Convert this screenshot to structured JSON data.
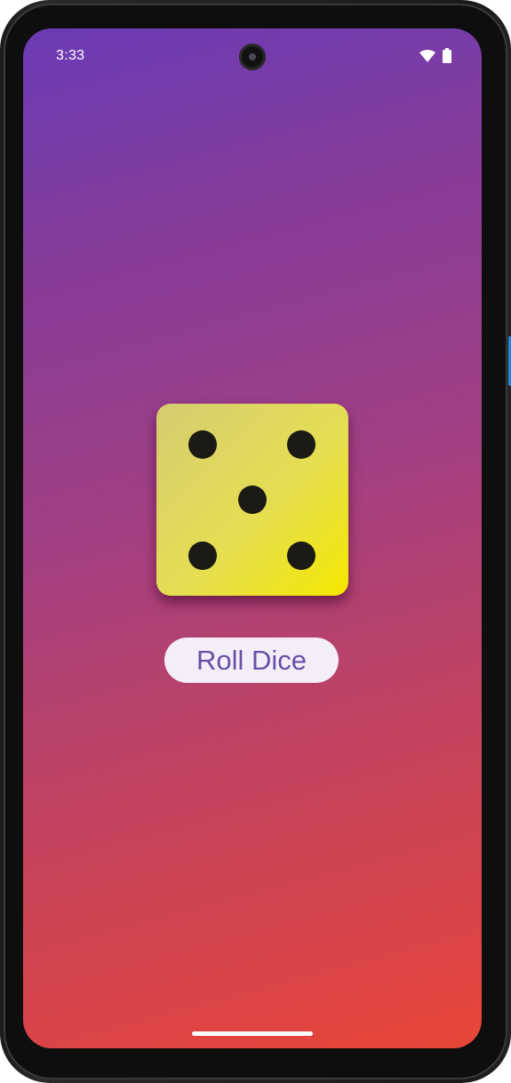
{
  "statusbar": {
    "time": "3:33",
    "icons": [
      "wifi-icon",
      "battery-icon"
    ]
  },
  "dice": {
    "face_value": 5
  },
  "actions": {
    "roll_label": "Roll Dice"
  },
  "colors": {
    "background_top": "#6b3bb5",
    "background_bottom": "#e84538",
    "dice_light": "#d6cc72",
    "dice_dark": "#f5e800",
    "pip": "#1b1a15",
    "button_bg": "#f4eef8",
    "button_text": "#6a4fa8"
  }
}
